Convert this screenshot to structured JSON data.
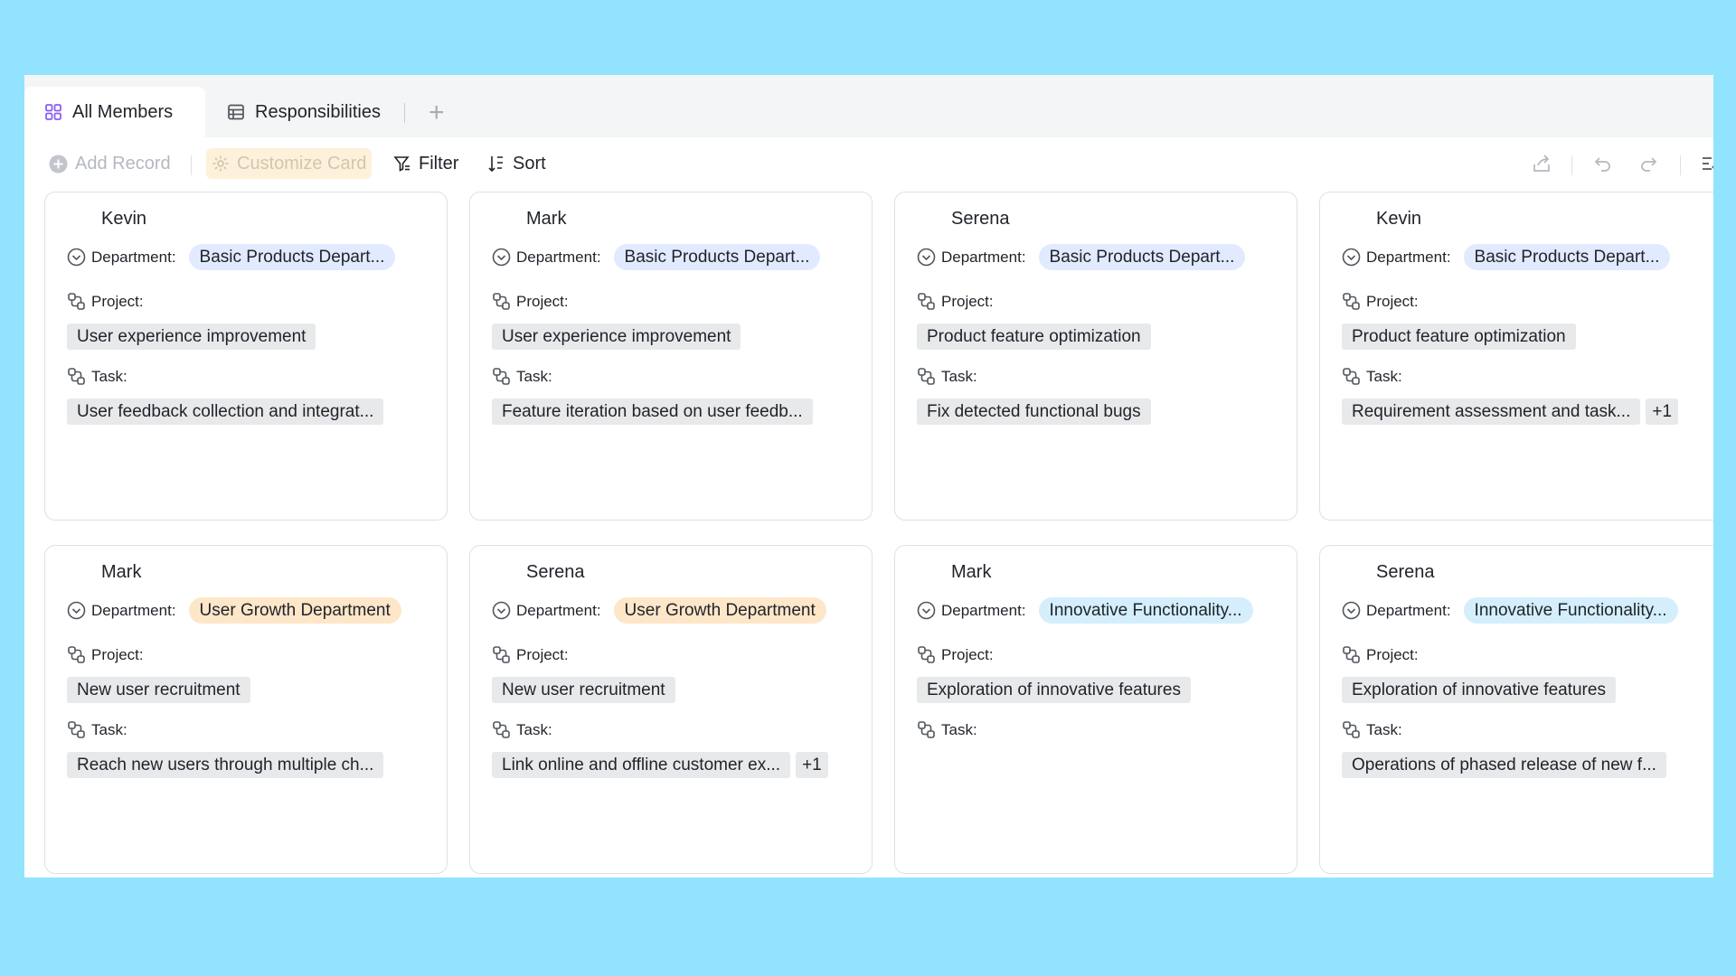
{
  "tabs": [
    {
      "label": "All Members",
      "icon": "grid-icon",
      "active": true
    },
    {
      "label": "Responsibilities",
      "icon": "table-icon",
      "active": false
    }
  ],
  "toolbar": {
    "add_record": "Add Record",
    "customize_card": "Customize Card",
    "filter": "Filter",
    "sort": "Sort"
  },
  "field_labels": {
    "department": "Department:",
    "project": "Project:",
    "task": "Task:"
  },
  "colors": {
    "background": "#92e3fd",
    "blue_pill": "#e1eaff",
    "orange_pill": "#fee6c9",
    "cyan_pill": "#d4eefc",
    "tag": "#e8e9eb"
  },
  "cards": [
    {
      "name": "Kevin",
      "department": "Basic Products Depart...",
      "project": "User experience improvement",
      "task": "User feedback collection and integrat...",
      "extra": ""
    },
    {
      "name": "Mark",
      "department": "Basic Products Depart...",
      "project": "User experience improvement",
      "task": "Feature iteration based on user feedb...",
      "extra": ""
    },
    {
      "name": "Serena",
      "department": "Basic Products Depart...",
      "project": "Product feature optimization",
      "task": "Fix detected functional bugs",
      "extra": ""
    },
    {
      "name": "Kevin",
      "department": "Basic Products Depart...",
      "project": "Product feature optimization",
      "task": "Requirement assessment and task...",
      "extra": "+1"
    },
    {
      "name": "Mark",
      "department": "User Growth Department",
      "project": "New user recruitment",
      "task": "Reach new users through multiple ch...",
      "extra": ""
    },
    {
      "name": "Serena",
      "department": "User Growth Department",
      "project": "New user recruitment",
      "task": "Link online and offline customer ex...",
      "extra": "+1"
    },
    {
      "name": "Mark",
      "department": "Innovative Functionality...",
      "project": "Exploration of innovative features",
      "task": "",
      "extra": ""
    },
    {
      "name": "Serena",
      "department": "Innovative Functionality...",
      "project": "Exploration of innovative features",
      "task": "Operations of phased release of new f...",
      "extra": ""
    }
  ]
}
